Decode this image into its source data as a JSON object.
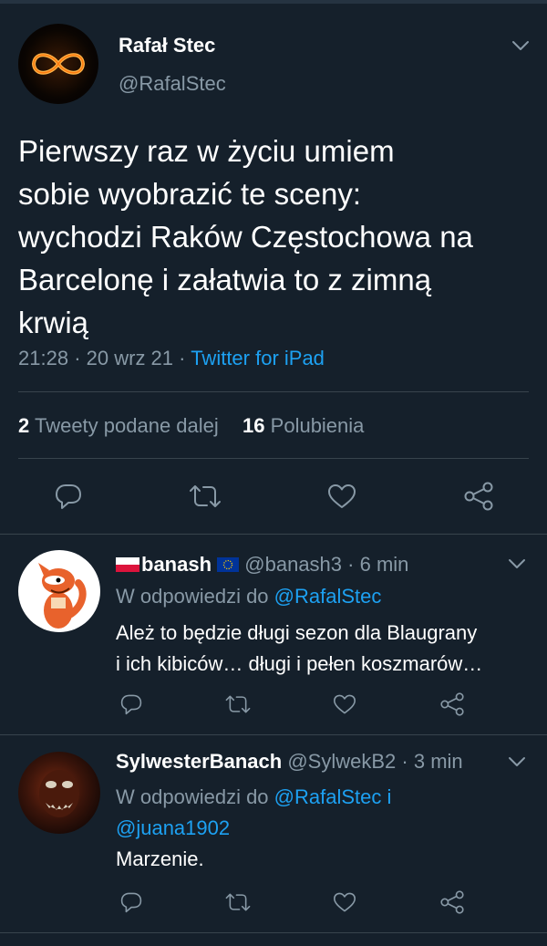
{
  "main_tweet": {
    "display_name": "Rafał Stec",
    "handle": "@RafalStec",
    "text_lines": [
      "Pierwszy raz w życiu umiem",
      "sobie wyobrazić te sceny:",
      "wychodzi Raków Częstochowa na",
      "Barcelonę i załatwia to z zimną",
      "krwią"
    ],
    "time": "21:28",
    "date": "20 wrz 21",
    "separator": "·",
    "source": "Twitter for iPad",
    "retweets_count": "2",
    "retweets_label": "Tweety podane dalej",
    "likes_count": "16",
    "likes_label": "Polubienia"
  },
  "replies": [
    {
      "flag": "🇵🇱",
      "display_name": "banash",
      "badge": "🇪🇺",
      "handle": "@banash3",
      "separator": "·",
      "time": "6 min",
      "reply_prefix": "W odpowiedzi do",
      "reply_to": "@RafalStec",
      "text_lines": [
        "Ależ to będzie długi sezon dla Blaugrany",
        "i ich kibiców… długi i pełen koszmarów…"
      ]
    },
    {
      "display_name": "SylwesterBanach",
      "handle": "@SylwekB2",
      "separator": "·",
      "time": "3 min",
      "reply_prefix": "W odpowiedzi do",
      "reply_to": "@RafalStec i",
      "reply_to_2": "@juana1902",
      "text": "Marzenie."
    }
  ],
  "icons": {
    "reply": "reply-icon",
    "retweet": "retweet-icon",
    "like": "heart-icon",
    "share": "share-icon",
    "more": "chevron-down-icon"
  },
  "colors": {
    "background": "#15202b",
    "accent": "#1da1f2",
    "muted": "#8899a6",
    "divider": "#38444d"
  }
}
